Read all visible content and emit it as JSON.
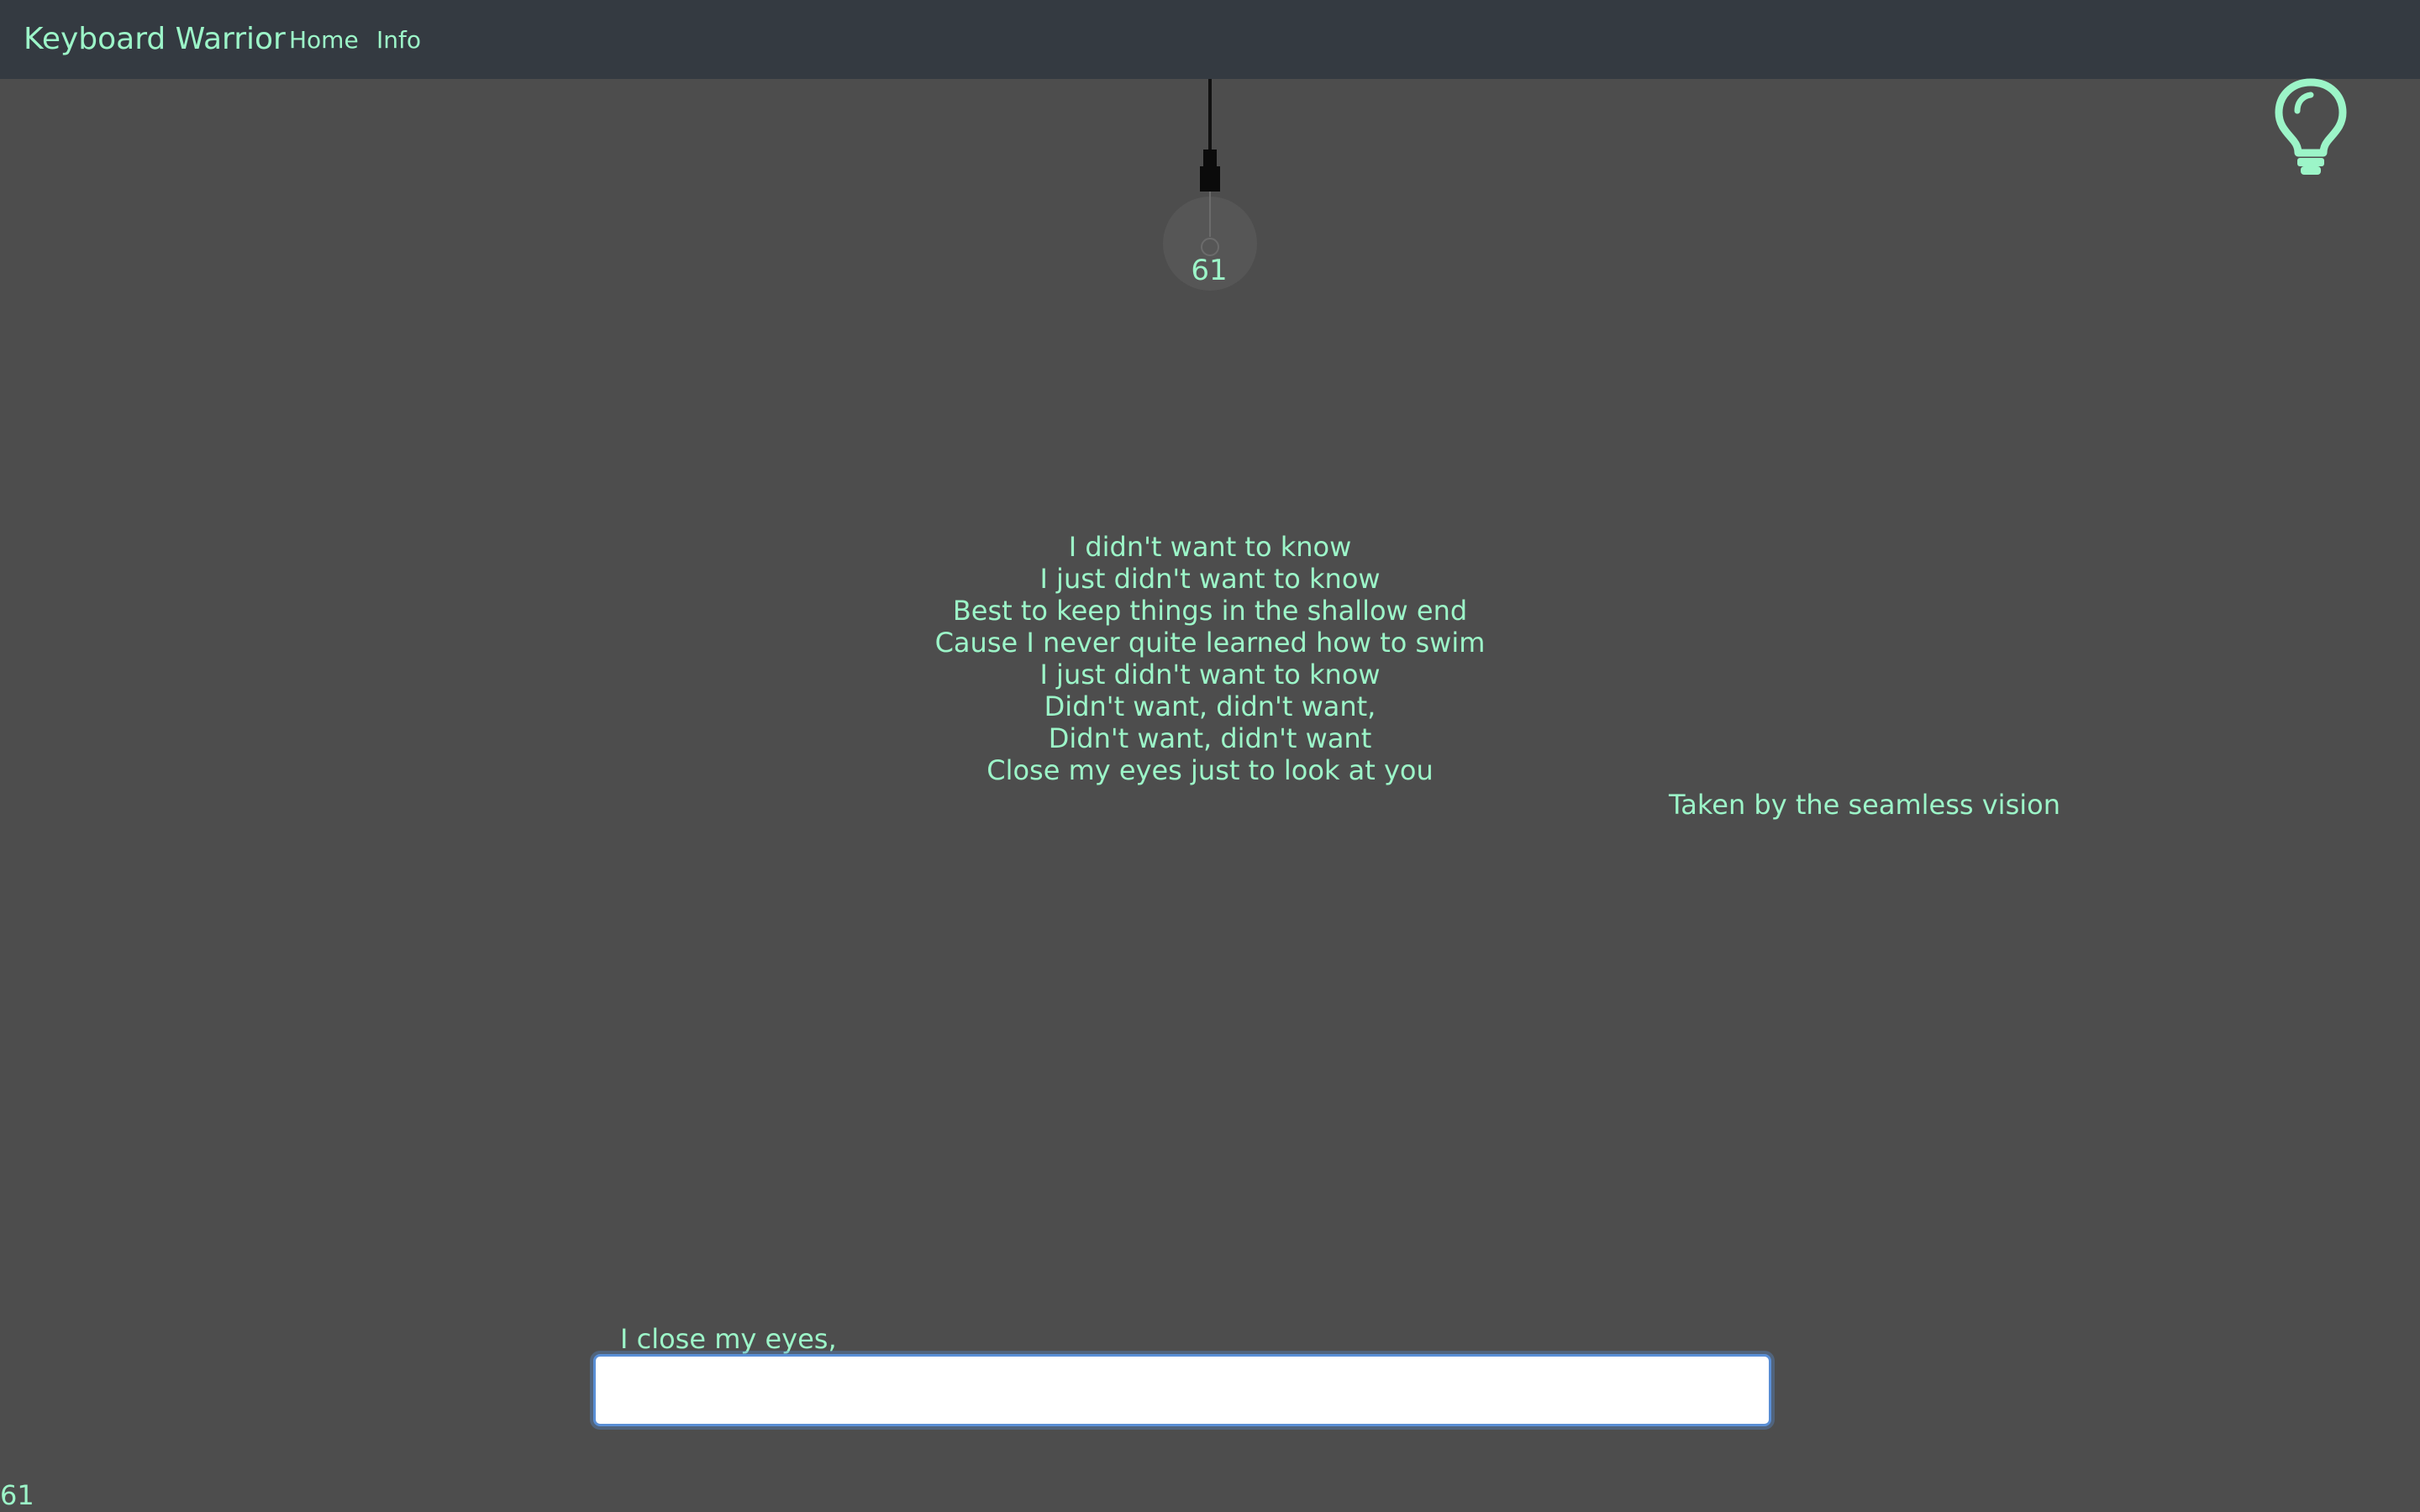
{
  "navbar": {
    "brand": "Keyboard Warrior",
    "links": [
      {
        "label": "Home"
      },
      {
        "label": "Info"
      }
    ]
  },
  "lamp": {
    "counter": "61"
  },
  "hint": {
    "icon": "lightbulb-icon"
  },
  "lyrics": {
    "lines": [
      "I didn't want to know",
      "I just didn't want to know",
      "Best to keep things in the shallow end",
      "Cause I never quite learned how to swim",
      "I just didn't want to know",
      "Didn't want, didn't want,",
      "Didn't want, didn't want",
      "Close my eyes just to look at you"
    ]
  },
  "floating_word": "Taken by the seamless vision",
  "prompt": {
    "current_line": "I close my eyes,",
    "input_value": "",
    "input_placeholder": ""
  },
  "footer": {
    "counter": "61"
  },
  "colors": {
    "accent": "#9cf5c8",
    "background": "#4d4d4d",
    "navbar": "#343a41",
    "input_border": "#5a8fd6"
  }
}
